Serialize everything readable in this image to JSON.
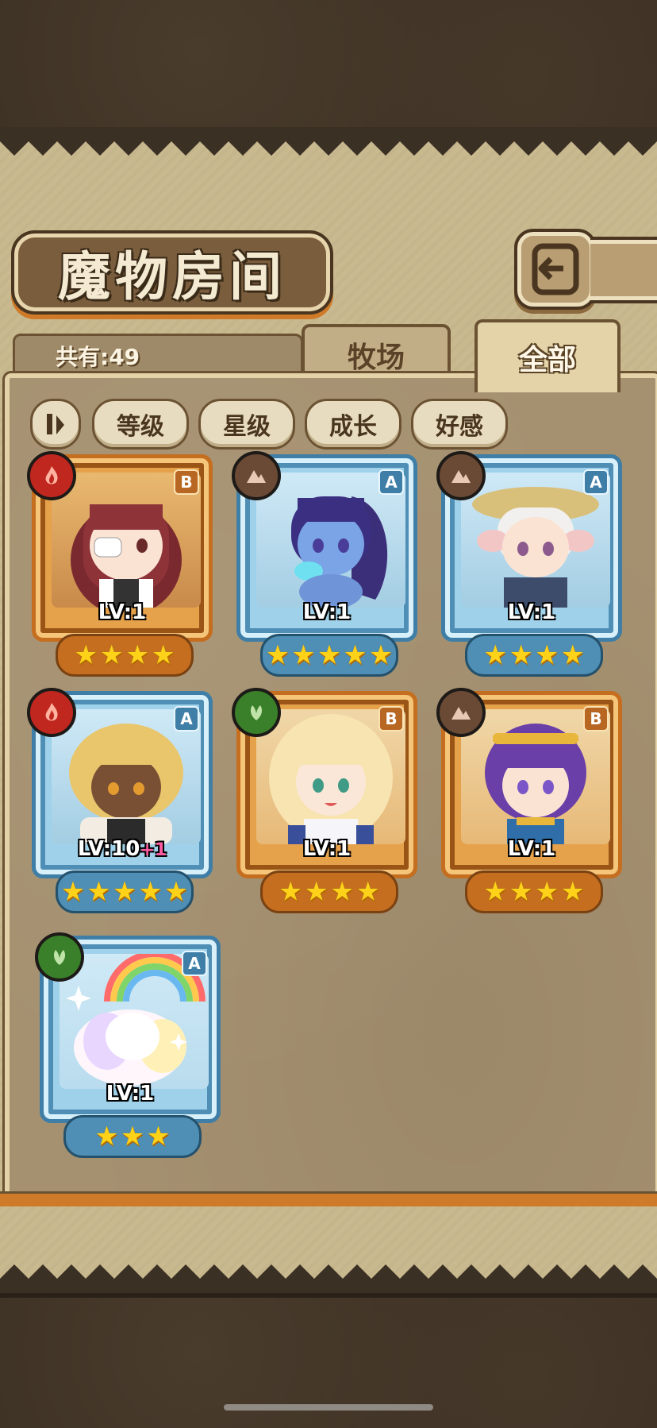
{
  "header": {
    "title": "魔物房间"
  },
  "tabs": {
    "ranch_label": "牧场",
    "all_label": "全部"
  },
  "count": {
    "label": "共有:49"
  },
  "filters": {
    "level": "等级",
    "star": "星级",
    "growth": "成长",
    "affection": "好感"
  },
  "icons": {
    "back": "return-arrow-icon",
    "sort": "sort-toggle-icon",
    "fire": "fire-element-icon",
    "earth": "mountain-element-icon",
    "wood": "leaf-element-icon"
  },
  "colors": {
    "gold_frame": "#c56e1f",
    "blue_frame": "#3f7ea6",
    "star": "#ffd21a",
    "plus": "#ff5ba2"
  },
  "monsters": [
    {
      "grade": "B",
      "element": "fire",
      "frame": "gold",
      "level": "LV:1",
      "plus": "",
      "stars": 4
    },
    {
      "grade": "A",
      "element": "earth",
      "frame": "blue",
      "level": "LV:1",
      "plus": "",
      "stars": 5
    },
    {
      "grade": "A",
      "element": "earth",
      "frame": "blue",
      "level": "LV:1",
      "plus": "",
      "stars": 4
    },
    {
      "grade": "A",
      "element": "fire",
      "frame": "blue",
      "level": "LV:10",
      "plus": "+1",
      "stars": 5
    },
    {
      "grade": "B",
      "element": "wood",
      "frame": "gold",
      "level": "LV:1",
      "plus": "",
      "stars": 4
    },
    {
      "grade": "B",
      "element": "earth",
      "frame": "gold",
      "level": "LV:1",
      "plus": "",
      "stars": 4
    },
    {
      "grade": "A",
      "element": "wood",
      "frame": "blue",
      "level": "LV:1",
      "plus": "",
      "stars": 3
    }
  ]
}
